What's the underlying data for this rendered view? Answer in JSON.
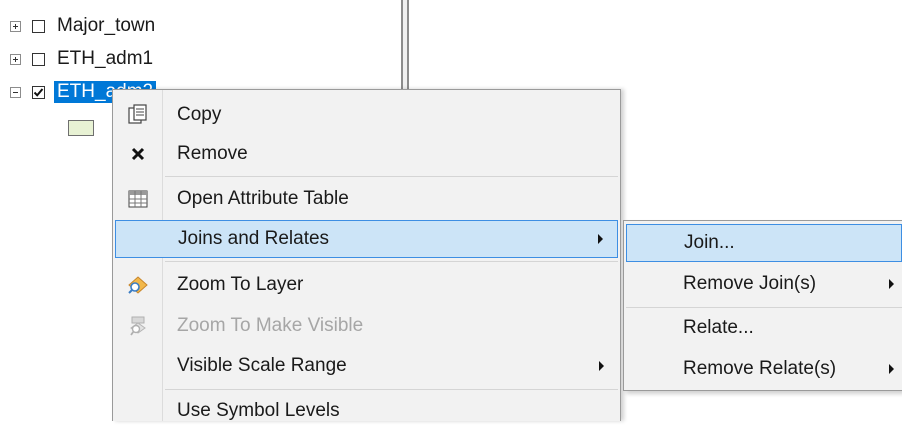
{
  "toc": {
    "layers": [
      {
        "label": "Major_town",
        "expanded": false,
        "checked": false,
        "selected": false
      },
      {
        "label": "ETH_adm1",
        "expanded": false,
        "checked": false,
        "selected": false
      },
      {
        "label": "ETH_adm2",
        "expanded": true,
        "checked": true,
        "selected": true
      }
    ],
    "legend_swatch_color": "#e8f2d4",
    "selection_color": "#0078d7"
  },
  "context_menu": {
    "items": [
      {
        "label": "Copy",
        "icon": "copy-icon",
        "enabled": true
      },
      {
        "label": "Remove",
        "icon": "remove-x-icon",
        "enabled": true
      },
      {
        "label": "Open Attribute Table",
        "icon": "attribute-table-icon",
        "enabled": true
      },
      {
        "label": "Joins and Relates",
        "icon": "",
        "enabled": true,
        "highlighted": true,
        "has_submenu": true
      },
      {
        "label": "Zoom To Layer",
        "icon": "zoom-to-layer-icon",
        "enabled": true
      },
      {
        "label": "Zoom To Make Visible",
        "icon": "zoom-to-make-visible-icon",
        "enabled": false
      },
      {
        "label": "Visible Scale Range",
        "icon": "",
        "enabled": true,
        "has_submenu": true
      },
      {
        "label": "Use Symbol Levels",
        "icon": "",
        "enabled": true
      }
    ]
  },
  "submenu": {
    "items": [
      {
        "label": "Join...",
        "highlighted": true
      },
      {
        "label": "Remove Join(s)",
        "has_submenu": true
      },
      {
        "label": "Relate..."
      },
      {
        "label": "Remove Relate(s)",
        "has_submenu": true
      }
    ]
  },
  "colors": {
    "menu_background": "#f2f2f2",
    "highlight_background": "#cce4f7",
    "highlight_border": "#3d8ee3"
  }
}
